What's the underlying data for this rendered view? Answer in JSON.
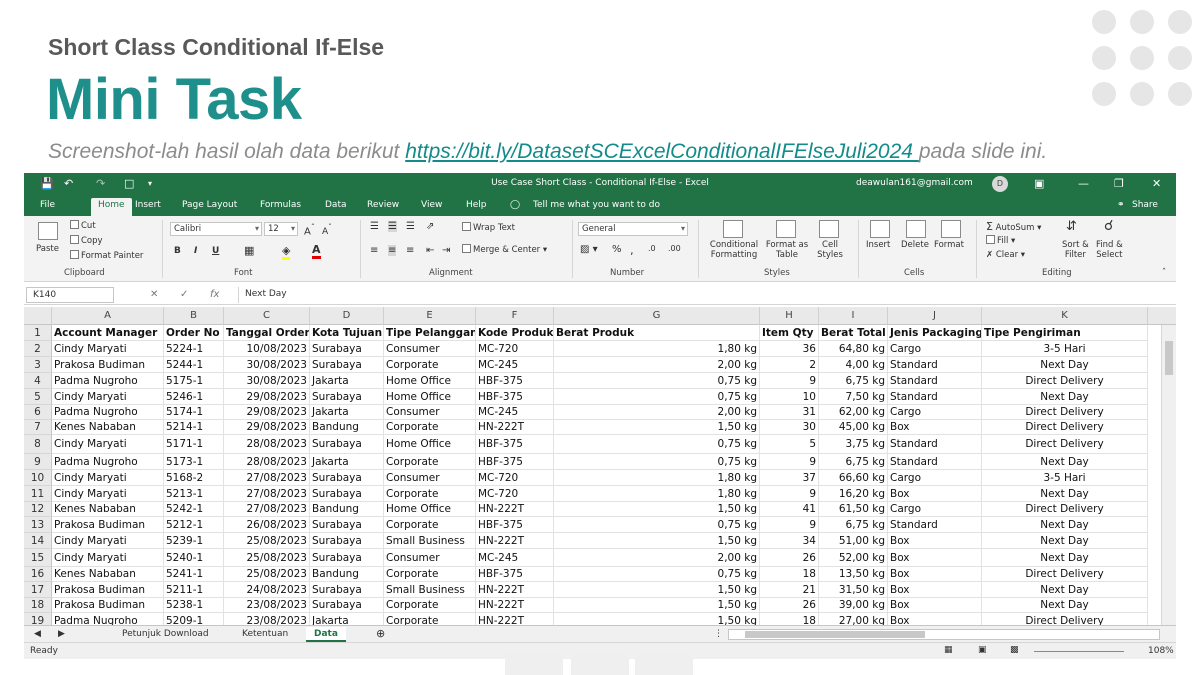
{
  "slide": {
    "subtitle": "Short Class Conditional If-Else",
    "title": "Mini Task",
    "desc_before": "Screenshot-lah hasil olah data berikut ",
    "desc_link": "https://bit.ly/DatasetSCExcelConditionalIFElseJuli2024 ",
    "desc_after": "pada slide ini."
  },
  "window": {
    "title": "Use Case Short Class - Conditional If-Else  -  Excel",
    "user_email": "deawulan161@gmail.com",
    "avatar_letter": "D"
  },
  "tabs": [
    "File",
    "Home",
    "Insert",
    "Page Layout",
    "Formulas",
    "Data",
    "Review",
    "View",
    "Help"
  ],
  "tell_me": "Tell me what you want to do",
  "share": "Share",
  "ribbon": {
    "clipboard": {
      "paste": "Paste",
      "cut": "Cut",
      "copy": "Copy",
      "format_painter": "Format Painter",
      "label": "Clipboard"
    },
    "font": {
      "name": "Calibri",
      "size": "12",
      "bold": "B",
      "italic": "I",
      "underline": "U",
      "label": "Font"
    },
    "alignment": {
      "wrap": "Wrap Text",
      "merge": "Merge & Center",
      "label": "Alignment"
    },
    "number": {
      "format": "General",
      "label": "Number"
    },
    "styles": {
      "conditional_1": "Conditional",
      "conditional_2": "Formatting",
      "table_1": "Format as",
      "table_2": "Table",
      "cell_1": "Cell",
      "cell_2": "Styles",
      "label": "Styles"
    },
    "cells": {
      "insert": "Insert",
      "delete": "Delete",
      "format": "Format",
      "label": "Cells"
    },
    "editing": {
      "autosum": "AutoSum",
      "fill": "Fill",
      "clear": "Clear",
      "sort_1": "Sort &",
      "sort_2": "Filter",
      "find_1": "Find &",
      "find_2": "Select",
      "label": "Editing"
    }
  },
  "formula_bar": {
    "name_box": "K140",
    "fx": "fx",
    "content": "Next Day"
  },
  "columns": [
    "A",
    "B",
    "C",
    "D",
    "E",
    "F",
    "G",
    "H",
    "I",
    "J",
    "K"
  ],
  "header_row": [
    "Account Manager",
    "Order No",
    "Tanggal Order",
    "Kota Tujuan",
    "Tipe Pelanggan",
    "Kode Produk",
    "Berat Produk",
    "Item Qty",
    "Berat Total",
    "Jenis Packaging",
    "Tipe Pengiriman"
  ],
  "rows": [
    [
      "Cindy Maryati",
      "5224-1",
      "10/08/2023",
      "Surabaya",
      "Consumer",
      "MC-720",
      "1,80 kg",
      "36",
      "64,80 kg",
      "Cargo",
      "3-5 Hari"
    ],
    [
      "Prakosa Budiman",
      "5244-1",
      "30/08/2023",
      "Surabaya",
      "Corporate",
      "MC-245",
      "2,00 kg",
      "2",
      "4,00 kg",
      "Standard",
      "Next Day"
    ],
    [
      "Padma Nugroho",
      "5175-1",
      "30/08/2023",
      "Jakarta",
      "Home Office",
      "HBF-375",
      "0,75 kg",
      "9",
      "6,75 kg",
      "Standard",
      "Direct Delivery"
    ],
    [
      "Cindy Maryati",
      "5246-1",
      "29/08/2023",
      "Surabaya",
      "Home Office",
      "HBF-375",
      "0,75 kg",
      "10",
      "7,50 kg",
      "Standard",
      "Next Day"
    ],
    [
      "Padma Nugroho",
      "5174-1",
      "29/08/2023",
      "Jakarta",
      "Consumer",
      "MC-245",
      "2,00 kg",
      "31",
      "62,00 kg",
      "Cargo",
      "Direct Delivery"
    ],
    [
      "Kenes Nababan",
      "5214-1",
      "29/08/2023",
      "Bandung",
      "Corporate",
      "HN-222T",
      "1,50 kg",
      "30",
      "45,00 kg",
      "Box",
      "Direct Delivery"
    ],
    [
      "Cindy Maryati",
      "5171-1",
      "28/08/2023",
      "Surabaya",
      "Home Office",
      "HBF-375",
      "0,75 kg",
      "5",
      "3,75 kg",
      "Standard",
      "Direct Delivery"
    ],
    [
      "Padma Nugroho",
      "5173-1",
      "28/08/2023",
      "Jakarta",
      "Corporate",
      "HBF-375",
      "0,75 kg",
      "9",
      "6,75 kg",
      "Standard",
      "Next Day"
    ],
    [
      "Cindy Maryati",
      "5168-2",
      "27/08/2023",
      "Surabaya",
      "Consumer",
      "MC-720",
      "1,80 kg",
      "37",
      "66,60 kg",
      "Cargo",
      "3-5 Hari"
    ],
    [
      "Cindy Maryati",
      "5213-1",
      "27/08/2023",
      "Surabaya",
      "Corporate",
      "MC-720",
      "1,80 kg",
      "9",
      "16,20 kg",
      "Box",
      "Next Day"
    ],
    [
      "Kenes Nababan",
      "5242-1",
      "27/08/2023",
      "Bandung",
      "Home Office",
      "HN-222T",
      "1,50 kg",
      "41",
      "61,50 kg",
      "Cargo",
      "Direct Delivery"
    ],
    [
      "Prakosa Budiman",
      "5212-1",
      "26/08/2023",
      "Surabaya",
      "Corporate",
      "HBF-375",
      "0,75 kg",
      "9",
      "6,75 kg",
      "Standard",
      "Next Day"
    ],
    [
      "Cindy Maryati",
      "5239-1",
      "25/08/2023",
      "Surabaya",
      "Small Business",
      "HN-222T",
      "1,50 kg",
      "34",
      "51,00 kg",
      "Box",
      "Next Day"
    ],
    [
      "Cindy Maryati",
      "5240-1",
      "25/08/2023",
      "Surabaya",
      "Consumer",
      "MC-245",
      "2,00 kg",
      "26",
      "52,00 kg",
      "Box",
      "Next Day"
    ],
    [
      "Kenes Nababan",
      "5241-1",
      "25/08/2023",
      "Bandung",
      "Corporate",
      "HBF-375",
      "0,75 kg",
      "18",
      "13,50 kg",
      "Box",
      "Direct Delivery"
    ],
    [
      "Prakosa Budiman",
      "5211-1",
      "24/08/2023",
      "Surabaya",
      "Small Business",
      "HN-222T",
      "1,50 kg",
      "21",
      "31,50 kg",
      "Box",
      "Next Day"
    ],
    [
      "Prakosa Budiman",
      "5238-1",
      "23/08/2023",
      "Surabaya",
      "Corporate",
      "HN-222T",
      "1,50 kg",
      "26",
      "39,00 kg",
      "Box",
      "Next Day"
    ],
    [
      "Padma Nugroho",
      "5209-1",
      "23/08/2023",
      "Jakarta",
      "Corporate",
      "HN-222T",
      "1,50 kg",
      "18",
      "27,00 kg",
      "Box",
      "Direct Delivery"
    ]
  ],
  "sheets": [
    "Petunjuk Download",
    "Ketentuan",
    "Data"
  ],
  "active_sheet": "Data",
  "status": {
    "ready": "Ready",
    "zoom": "108%"
  },
  "colors": {
    "excel_green": "#217346",
    "title_teal": "#1f8f8c"
  }
}
